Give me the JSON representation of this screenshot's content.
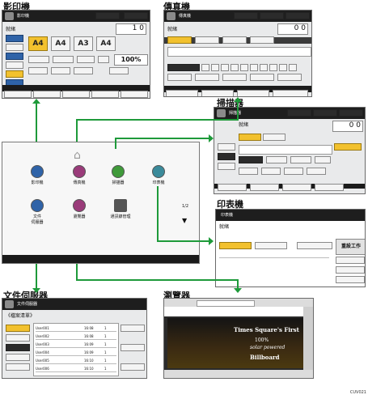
{
  "captions": {
    "copier": "影印機",
    "fax": "傳真機",
    "scanner": "掃描器",
    "printer": "印表機",
    "docserver": "文件伺服器",
    "browser": "瀏覽器"
  },
  "copier_screen": {
    "title": "影印機",
    "status": "就緒",
    "counter": "1 0",
    "zoom": "100%",
    "paper_sizes": [
      "A4",
      "A4",
      "A3",
      "A4"
    ]
  },
  "fax_screen": {
    "title": "傳真機",
    "status": "就緒",
    "counter": "0 0"
  },
  "scanner_screen": {
    "title": "掃描器",
    "status": "就緒",
    "counter": "0 0"
  },
  "printer_screen": {
    "title": "印表機",
    "status": "就緒",
    "button": "重設工作"
  },
  "docserver_screen": {
    "title": "文件伺服器",
    "header": "《檔案清單》",
    "rows": [
      {
        "name": "User001",
        "time": "16:08",
        "page": "1"
      },
      {
        "name": "User002",
        "time": "16:08",
        "page": "1"
      },
      {
        "name": "User003",
        "time": "16:09",
        "page": "1"
      },
      {
        "name": "User004",
        "time": "16:09",
        "page": "1"
      },
      {
        "name": "User005",
        "time": "16:10",
        "page": "1"
      },
      {
        "name": "User006",
        "time": "16:10",
        "page": "1"
      }
    ]
  },
  "browser_screen": {
    "banner_line1": "Times Square's First",
    "banner_line2": "100%",
    "banner_line3": "solar powered",
    "banner_line4": "Billboard"
  },
  "home_screen": {
    "page_indicator": "1/2",
    "apps": [
      {
        "label": "影印機",
        "color": "#2f63a8"
      },
      {
        "label": "傳真機",
        "color": "#9a3b7a"
      },
      {
        "label": "掃描器",
        "color": "#3f9a3a"
      },
      {
        "label": "印表機",
        "color": "#3a8a9a"
      },
      {
        "label": "文件\n伺服器",
        "color": "#2f63a8"
      },
      {
        "label": "瀏覽器",
        "color": "#9a3b7a"
      },
      {
        "label": "通訊錄管理",
        "color": "#555555"
      }
    ]
  },
  "figure_code": "CUV021",
  "colors": {
    "arrow": "#1e9a3a",
    "dark": "#1b1b1b"
  }
}
